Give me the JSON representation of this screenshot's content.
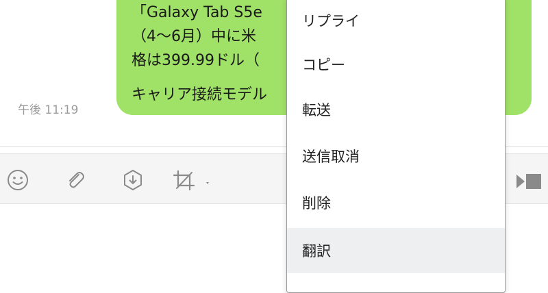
{
  "message": {
    "lines": [
      "「Galaxy Tab S5e",
      "（4〜6月）中に米",
      "格は399.99ドル（",
      "キャリア接続モデル"
    ],
    "timestamp": "午後 11:19",
    "bubble_color": "#a0e167"
  },
  "toolbar": {
    "icons": [
      "emoji-icon",
      "paperclip-icon",
      "download-icon",
      "crop-icon",
      "send-icon"
    ]
  },
  "context_menu": {
    "items": [
      {
        "label": "リプライ"
      },
      {
        "label": "コピー"
      },
      {
        "label": "転送"
      },
      {
        "label": "送信取消"
      },
      {
        "label": "削除"
      },
      {
        "label": "翻訳",
        "hovered": true
      }
    ]
  }
}
